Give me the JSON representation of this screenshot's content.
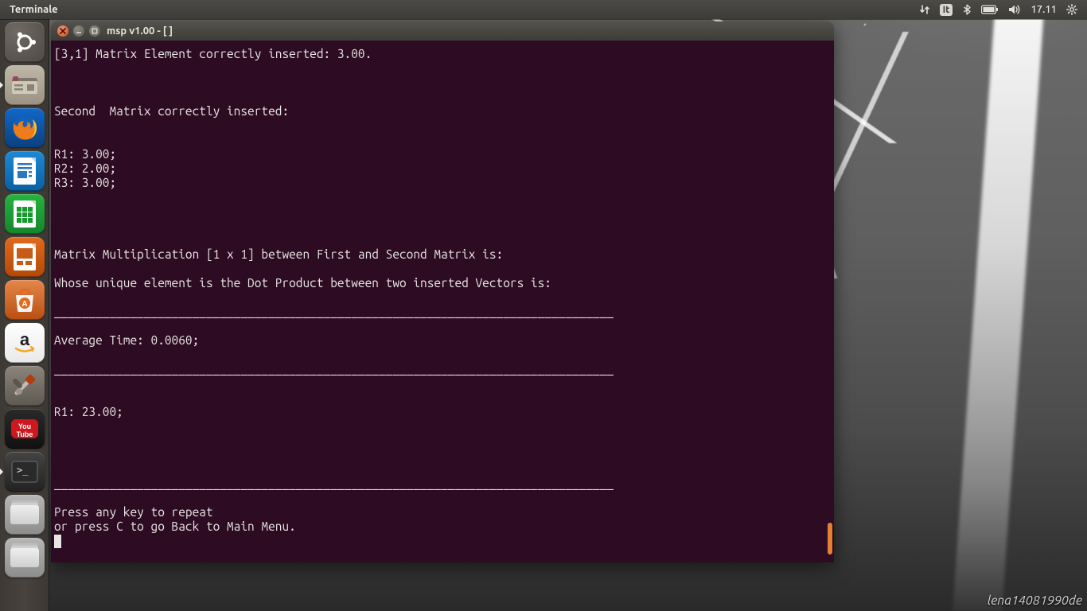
{
  "panel": {
    "app_title": "Terminale",
    "language": "It",
    "time": "17.11"
  },
  "launcher": {
    "items": [
      {
        "name": "ubuntu-dash"
      },
      {
        "name": "files",
        "running": true
      },
      {
        "name": "firefox"
      },
      {
        "name": "libreoffice-writer"
      },
      {
        "name": "libreoffice-calc"
      },
      {
        "name": "libreoffice-impress"
      },
      {
        "name": "ubuntu-software"
      },
      {
        "name": "amazon"
      },
      {
        "name": "system-settings"
      },
      {
        "name": "youtube"
      },
      {
        "name": "terminal",
        "running": true
      },
      {
        "name": "drive-1"
      },
      {
        "name": "drive-2"
      }
    ]
  },
  "window": {
    "title": "msp v1.00 - [ ]"
  },
  "terminal": {
    "lines": [
      "[3,1] Matrix Element correctly inserted: 3.00.",
      "",
      "",
      "",
      "Second  Matrix correctly inserted:",
      "",
      "",
      "R1: 3.00;",
      "R2: 2.00;",
      "R3: 3.00;",
      "",
      "",
      "",
      "",
      "Matrix Multiplication [1 x 1] between First and Second Matrix is:",
      "",
      "Whose unique element is the Dot Product between two inserted Vectors is:",
      "",
      "_________________________________________________________________________________",
      "",
      "Average Time: 0.0060;",
      "",
      "_________________________________________________________________________________",
      "",
      "",
      "R1: 23.00;",
      "",
      "",
      "",
      "",
      "_________________________________________________________________________________",
      "",
      "Press any key to repeat",
      "or press C to go Back to Main Menu."
    ]
  },
  "watermark": "lena14081990de"
}
